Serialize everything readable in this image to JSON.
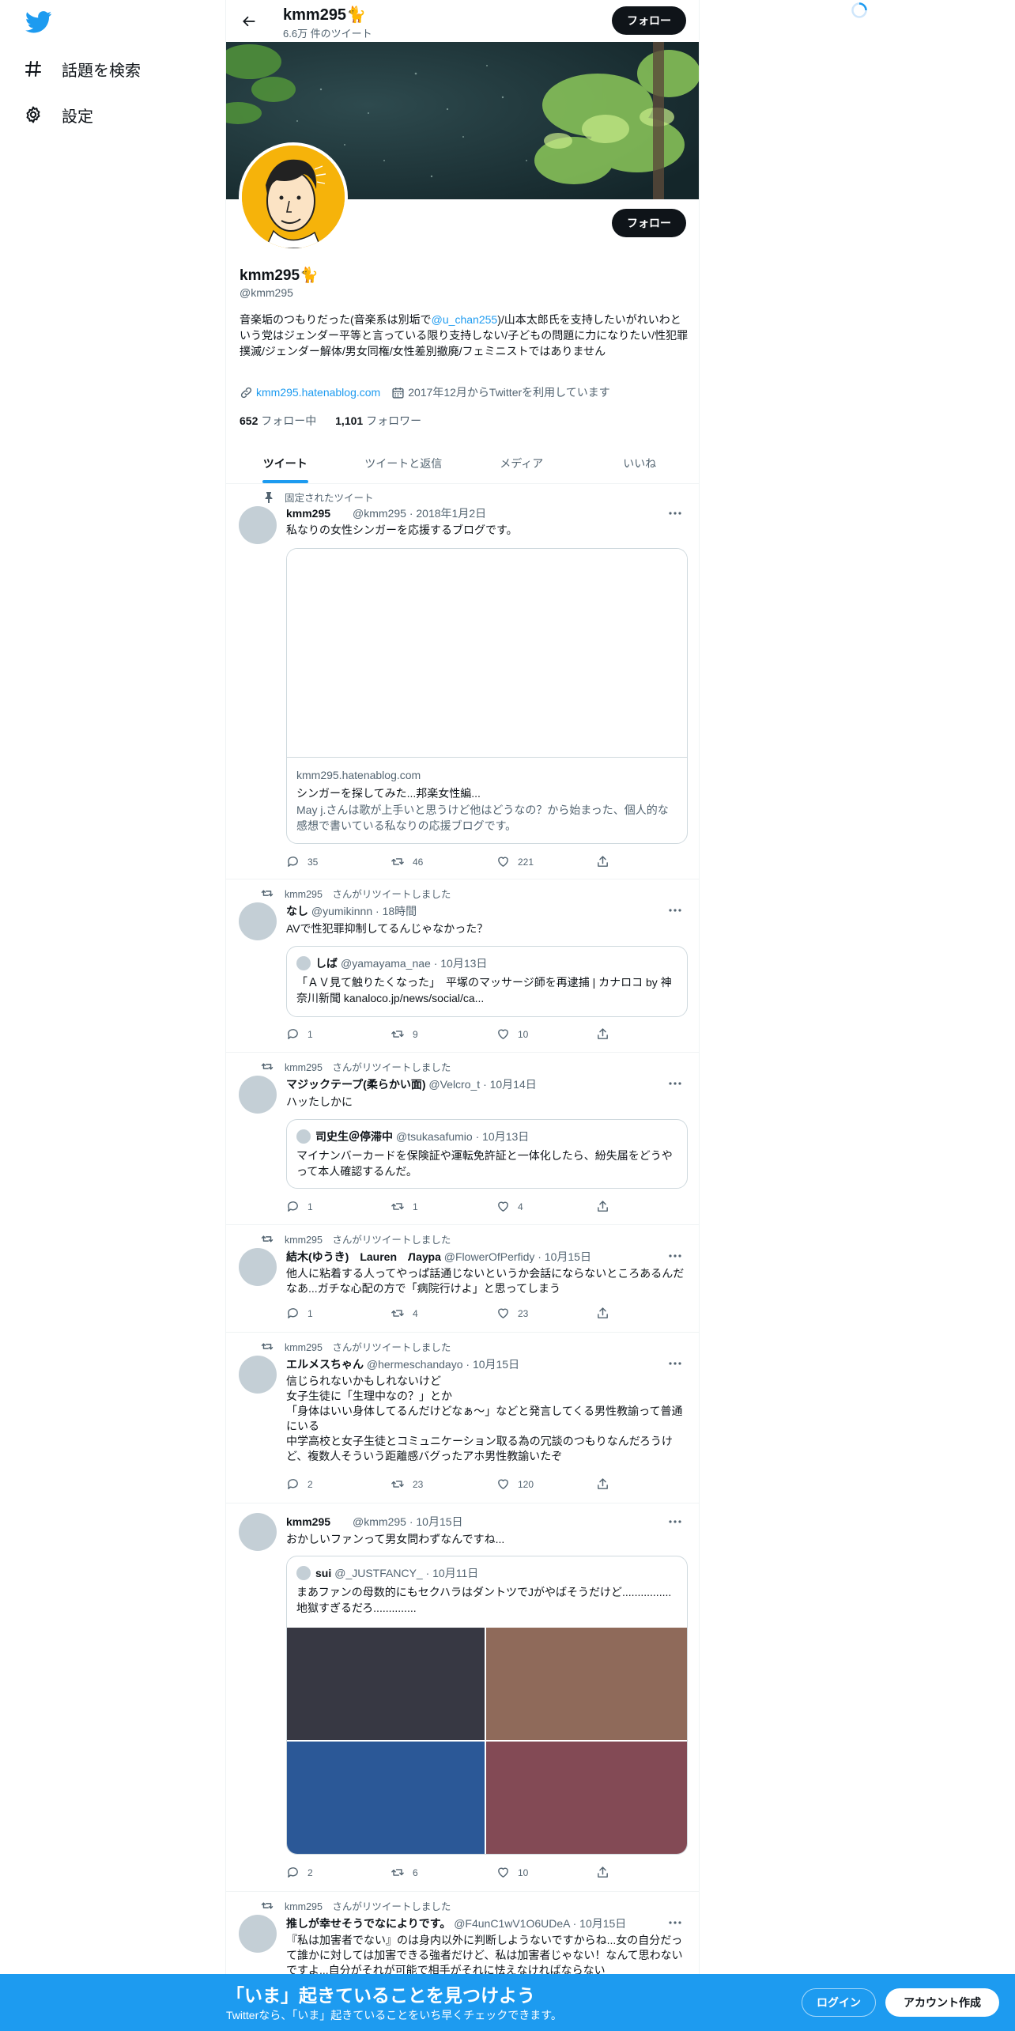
{
  "nav": {
    "items": [
      {
        "label": "話題を検索",
        "icon": "hashtag-icon"
      },
      {
        "label": "設定",
        "icon": "gear-icon"
      }
    ]
  },
  "topbar": {
    "name": "kmm295🐈",
    "tweet_count": "6.6万 件のツイート",
    "follow_label": "フォロー"
  },
  "profile": {
    "name": "kmm295🐈",
    "handle": "@kmm295",
    "follow_label": "フォロー",
    "bio_before": "音楽垢のつもりだった(音楽系は別垢で",
    "bio_mention": "@u_chan255",
    "bio_after": ")/山本太郎氏を支持したいがれいわという党はジェンダー平等と言っている限り支持しない/子どもの問題に力になりたい/性犯罪撲滅/ジェンダー解体/男女同権/女性差別撤廃/フェミニストではありません",
    "url": "kmm295.hatenablog.com",
    "joined": "2017年12月からTwitterを利用しています",
    "following_count": "652",
    "following_label": "フォロー中",
    "followers_count": "1,101",
    "followers_label": "フォロワー"
  },
  "tabs": [
    "ツイート",
    "ツイートと返信",
    "メディア",
    "いいね"
  ],
  "tweets": [
    {
      "context": "固定されたツイート",
      "name": "kmm295",
      "handle": "@kmm295 · 2018年1月2日",
      "text": "私なりの女性シンガーを応援するブログです。",
      "card_domain": "kmm295.hatenablog.com",
      "card_title": "シンガーを探してみた...邦楽女性編...",
      "card_desc": "May j.さんは歌が上手いと思うけど他はどうなの？から始まった、個人的な感想で書いている私なりの応援ブログです。",
      "reply": "35",
      "retweet": "46",
      "like": "221"
    },
    {
      "context": "kmm295　さんがリツイートしました",
      "name": "なし",
      "handle": "@yumikinnn · 18時間",
      "text": "AVで性犯罪抑制してるんじゃなかった？",
      "q_name": "しば",
      "q_handle": "@yamayama_nae · 10月13日",
      "q_text": "「ＡＶ見て触りたくなった」　平塚のマッサージ師を再逮捕 | カナロコ by 神奈川新聞 kanaloco.jp/news/social/ca...",
      "reply": "1",
      "retweet": "9",
      "like": "10"
    },
    {
      "context": "kmm295　さんがリツイートしました",
      "name": "マジックテープ(柔らかい面)",
      "handle": "@Velcro_t · 10月14日",
      "text": "ハッたしかに",
      "q_name": "司史生＠停滞中",
      "q_handle": "@tsukasafumio · 10月13日",
      "q_text": "マイナンバーカードを保険証や運転免許証と一体化したら、紛失届をどうやって本人確認するんだ。",
      "reply": "1",
      "retweet": "1",
      "like": "4"
    },
    {
      "context": "kmm295　さんがリツイートしました",
      "name": "結木(ゆうき)　Lauren　Лаура",
      "handle": "@FlowerOfPerfidy · 10月15日",
      "text": "他人に粘着する人ってやっぱ話通じないというか会話にならないところあるんだなあ...ガチな心配の方で「病院行けよ」と思ってしまう",
      "reply": "1",
      "retweet": "4",
      "like": "23"
    },
    {
      "context": "kmm295　さんがリツイートしました",
      "name": "エルメスちゃん",
      "handle": "@hermeschandayo · 10月15日",
      "text_lines": [
        "信じられないかもしれないけど",
        "女子生徒に「生理中なの？」とか",
        "「身体はいい身体してるんだけどなぁ〜」などと発言してくる男性教諭って普通にいる",
        "中学高校と女子生徒とコミュニケーション取る為の冗談のつもりなんだろうけど、複数人そういう距離感バグったアホ男性教諭いたぞ"
      ],
      "reply": "2",
      "retweet": "23",
      "like": "120"
    },
    {
      "name": "kmm295",
      "handle": "@kmm295 · 10月15日",
      "text": "おかしいファンって男女問わずなんですね...",
      "q_name": "sui",
      "q_handle": "@_JUSTFANCY_ · 10月11日",
      "q_text": "まあファンの母数的にもセクハラはダントツでJがやばそうだけど................地獄すぎるだろ..............",
      "reply": "2",
      "retweet": "6",
      "like": "10"
    },
    {
      "context": "kmm295　さんがリツイートしました",
      "name": "推しが幸せそうでなによりです。",
      "handle": "@F4unC1wV1O6UDeA · 10月15日",
      "text": "『私は加害者でない』のは身内以外に判断しようないですからね...女の自分だって誰かに対しては加害できる強者だけど、私は加害者じゃない！なんて思わないですよ...自分がそれが可能で相手がそれに怯えなければならない"
    }
  ],
  "bottom": {
    "title": "「いま」起きていることを見つけよう",
    "subtitle": "Twitterなら、「いま」起きていることをいち早くチェックできます。",
    "login": "ログイン",
    "signup": "アカウント作成"
  },
  "colors": {
    "accent": "#1d9bf0",
    "text": "#0f1419",
    "muted": "#536471",
    "border": "#eff3f4",
    "avatar_bg": "#f6b30a"
  }
}
